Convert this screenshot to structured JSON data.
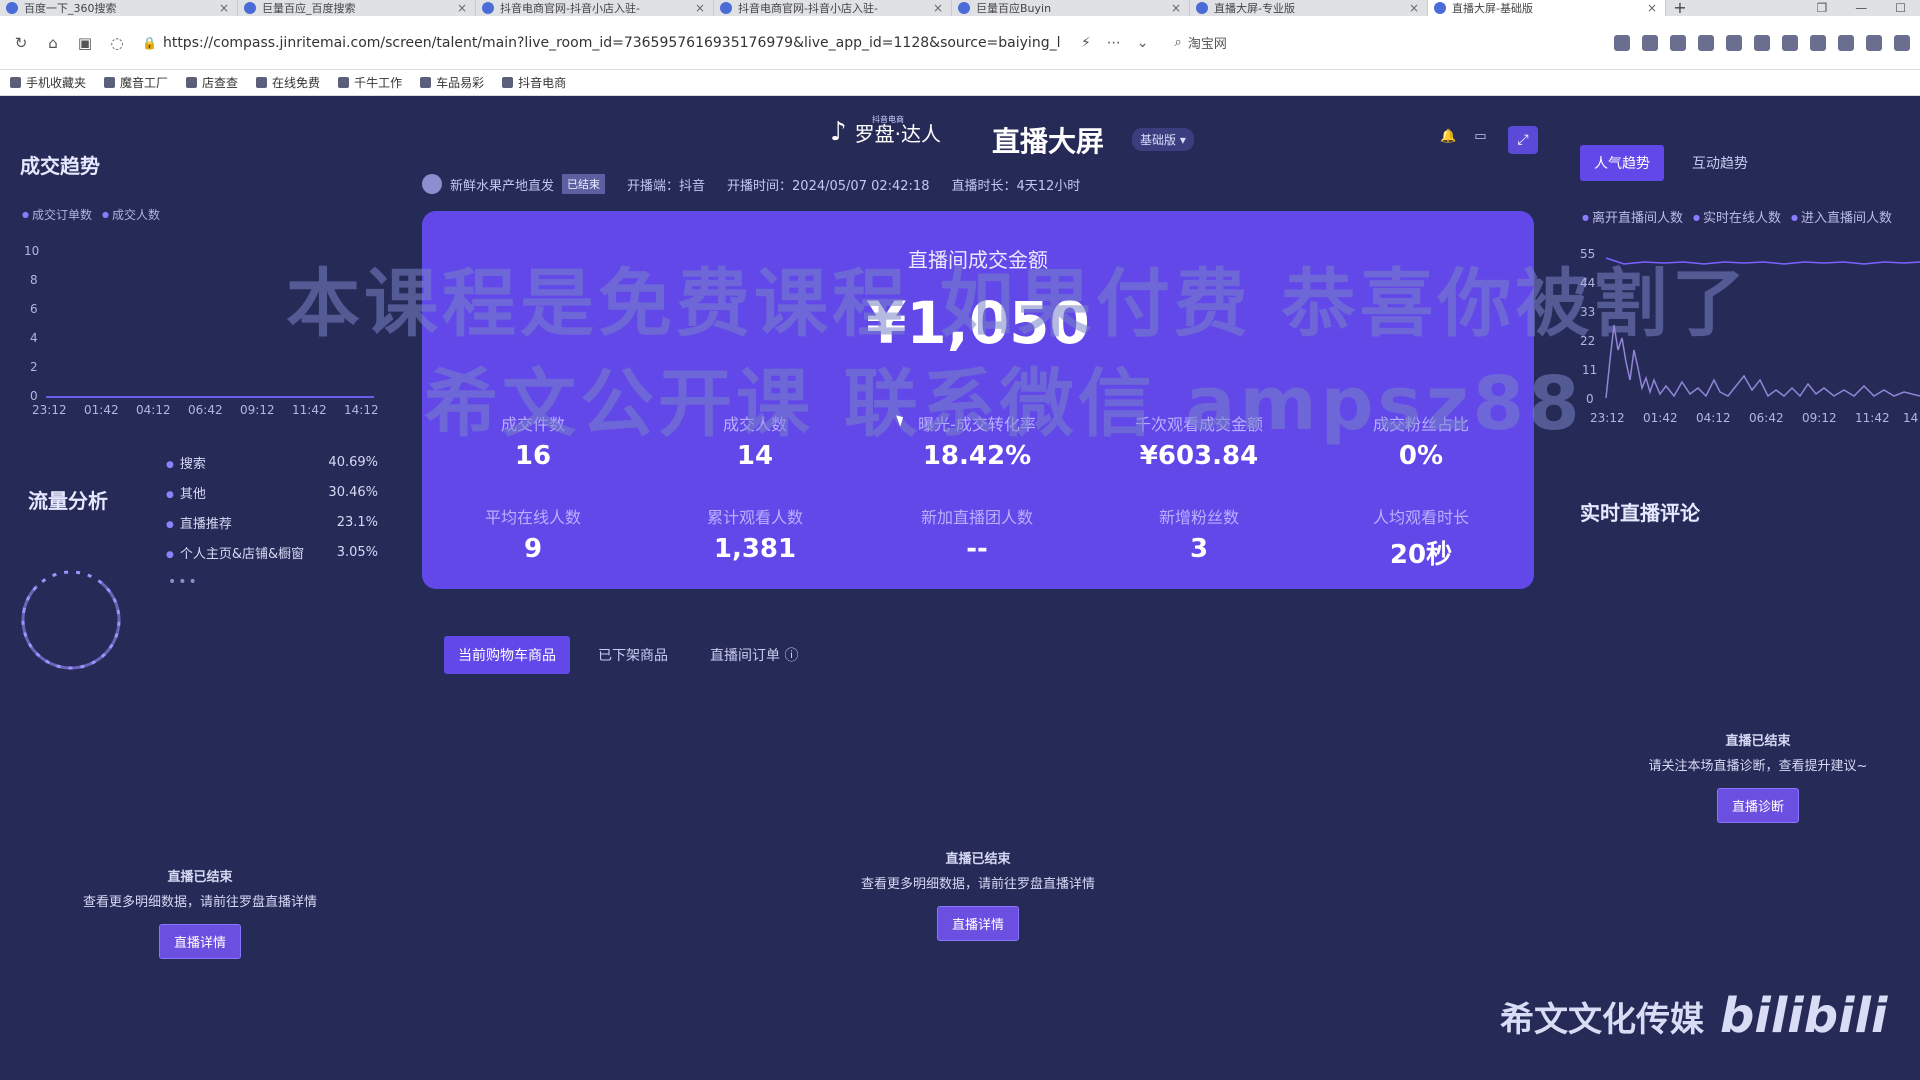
{
  "browser": {
    "tabs": [
      {
        "title": "百度一下_360搜索",
        "active": false
      },
      {
        "title": "巨量百应_百度搜索",
        "active": false
      },
      {
        "title": "抖音电商官网-抖音小店入驻-",
        "active": false
      },
      {
        "title": "抖音电商官网-抖音小店入驻-",
        "active": false
      },
      {
        "title": "巨量百应Buyin",
        "active": false
      },
      {
        "title": "直播大屏-专业版",
        "active": false
      },
      {
        "title": "直播大屏-基础版",
        "active": true
      }
    ],
    "url": "https://compass.jinritemai.com/screen/talent/main?live_room_id=7365957616935176979&live_app_id=1128&source=baiying_l",
    "search_site": "淘宝网",
    "bookmarks": [
      "手机收藏夹",
      "魔音工厂",
      "店查查",
      "在线免费",
      "千牛工作",
      "车品易彩",
      "抖音电商"
    ]
  },
  "left": {
    "trend_title": "成交趋势",
    "trend_legend": [
      "成交订单数",
      "成交人数"
    ],
    "trend_y_ticks": [
      "10",
      "8",
      "6",
      "4",
      "2",
      "0"
    ],
    "trend_x_ticks": [
      "23:12",
      "01:42",
      "04:12",
      "06:42",
      "09:12",
      "11:42",
      "14:12"
    ],
    "traffic_title": "流量分析",
    "traffic_items": [
      {
        "name": "搜索",
        "value": "40.69%"
      },
      {
        "name": "其他",
        "value": "30.46%"
      },
      {
        "name": "直播推荐",
        "value": "23.1%"
      },
      {
        "name": "个人主页&店铺&橱窗",
        "value": "3.05%"
      }
    ],
    "more": "•••",
    "ended_title": "直播已结束",
    "ended_sub": "查看更多明细数据，请前往罗盘直播详情",
    "ended_btn": "直播详情"
  },
  "header": {
    "brand_sub": "抖音电商",
    "brand_name": "罗盘·达人",
    "page_title": "直播大屏",
    "edition": "基础版 ▾",
    "room_name": "新鲜水果产地直发",
    "room_status": "已结束",
    "platform_label": "开播端：抖音",
    "start_time": "开播时间：2024/05/07 02:42:18",
    "duration": "直播时长：4天12小时"
  },
  "hero": {
    "title": "直播间成交金额",
    "amount": "¥1,050",
    "kpis": [
      {
        "label": "成交件数",
        "value": "16"
      },
      {
        "label": "成交人数",
        "value": "14"
      },
      {
        "label": "曝光-成交转化率",
        "value": "18.42%"
      },
      {
        "label": "千次观看成交金额",
        "value": "¥603.84"
      },
      {
        "label": "成交粉丝占比",
        "value": "0%"
      },
      {
        "label": "平均在线人数",
        "value": "9"
      },
      {
        "label": "累计观看人数",
        "value": "1,381"
      },
      {
        "label": "新加直播团人数",
        "value": "--"
      },
      {
        "label": "新增粉丝数",
        "value": "3"
      },
      {
        "label": "人均观看时长",
        "value": "20秒"
      }
    ]
  },
  "watermark": {
    "line1": "本课程是免费课程 如果付费 恭喜你被割了",
    "line2": "希文公开课 联系微信 ampsz88"
  },
  "products": {
    "tabs": [
      "当前购物车商品",
      "已下架商品",
      "直播间订单 ⓘ"
    ],
    "ended_title": "直播已结束",
    "ended_sub": "查看更多明细数据，请前往罗盘直播详情",
    "ended_btn": "直播详情"
  },
  "right": {
    "tabs": [
      "人气趋势",
      "互动趋势"
    ],
    "legend": [
      "离开直播间人数",
      "实时在线人数",
      "进入直播间人数"
    ],
    "y_ticks": [
      "55",
      "44",
      "33",
      "22",
      "11",
      "0"
    ],
    "x_ticks": [
      "23:12",
      "01:42",
      "04:12",
      "06:42",
      "09:12",
      "11:42",
      "14"
    ],
    "comments_title": "实时直播评论",
    "ended_title": "直播已结束",
    "ended_sub": "请关注本场直播诊断，查看提升建议~",
    "diag_btn": "直播诊断"
  },
  "footer": {
    "brand": "希文文化传媒",
    "bili": "bilibili"
  },
  "colors": {
    "bg": "#262a56",
    "accent": "#6248e8"
  }
}
